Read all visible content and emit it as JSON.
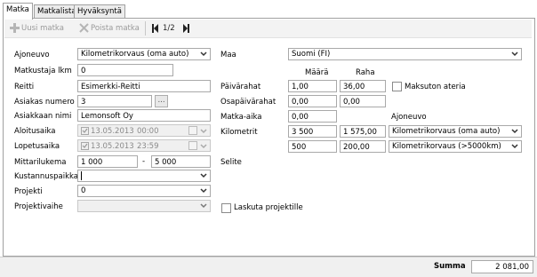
{
  "tabs": [
    "Matka",
    "Matkalista",
    "Hyväksyntä"
  ],
  "toolbar": {
    "new_trip": "Uusi matka",
    "delete_trip": "Poista matka",
    "pager": "1/2"
  },
  "form": {
    "ajoneuvo_label": "Ajoneuvo",
    "ajoneuvo_value": "Kilometrikorvaus (oma auto)",
    "matkustajia_label": "Matkustaja lkm",
    "matkustajia_value": "0",
    "reitti_label": "Reitti",
    "reitti_value": "Esimerkki-Reitti",
    "asiakas_label": "Asiakas numero",
    "asiakas_value": "3",
    "asiakas_btn": "...",
    "asiakkaan_nimi_label": "Asiakkaan nimi",
    "asiakkaan_nimi_value": "Lemonsoft Oy",
    "aloitusaika_label": "Aloitusaika",
    "aloitus_date": "13.05.2013",
    "aloitus_time": "00:00",
    "lopetusaika_label": "Lopetusaika",
    "lopetus_date": "13.05.2013",
    "lopetus_time": "23:59",
    "mittari_label": "Mittarilukema",
    "mittari_start": "1 000",
    "mittari_sep": "-",
    "mittari_end": "5 000",
    "kustannus_label": "Kustannuspaikka",
    "kustannus_value": "",
    "projekti_label": "Projekti",
    "projekti_value": "0",
    "projektivaihe_label": "Projektivaihe",
    "projektivaihe_value": ""
  },
  "right": {
    "maa_label": "Maa",
    "maa_value": "Suomi (FI)",
    "col_maara": "Määrä",
    "col_raha": "Raha",
    "col_ajoneuvo": "Ajoneuvo",
    "paivarahat_label": "Päivärahat",
    "paivarahat_maara": "1,00",
    "paivarahat_raha": "36,00",
    "maksuton_label": "Maksuton ateria",
    "osapaiva_label": "Osapäivärahat",
    "osapaiva_maara": "0,00",
    "osapaiva_raha": "0,00",
    "matka_aika_label": "Matka-aika",
    "matka_aika_value": "0,00",
    "kilometrit_label": "Kilometrit",
    "km_row1_maara": "3 500",
    "km_row1_raha": "1 575,00",
    "km_row1_vehicle": "Kilometrikorvaus (oma auto)",
    "km_row2_maara": "500",
    "km_row2_raha": "200,00",
    "km_row2_vehicle": "Kilometrikorvaus (>5000km)",
    "selite_label": "Selite",
    "laskuta_label": "Laskuta projektille"
  },
  "footer": {
    "summa_label": "Summa",
    "summa_value": "2 081,00"
  }
}
